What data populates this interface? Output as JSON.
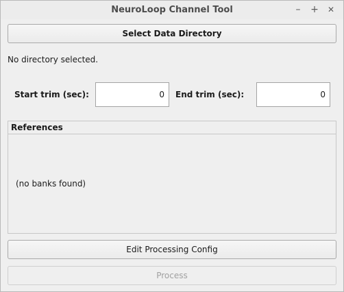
{
  "window": {
    "title": "NeuroLoop Channel Tool",
    "controls": [
      "minimize-icon",
      "maximize-icon",
      "close-icon"
    ],
    "minimize_glyph": "–",
    "maximize_glyph": "+",
    "close_glyph": "✕"
  },
  "directory": {
    "select_button": "Select Data Directory",
    "status": "No directory selected."
  },
  "trim": {
    "start_label": "Start trim (sec):",
    "start_value": "0",
    "end_label": "End trim (sec):",
    "end_value": "0"
  },
  "references": {
    "title": "References",
    "empty_text": "(no banks found)"
  },
  "actions": {
    "edit_config_button": "Edit Processing Config",
    "process_button": "Process"
  }
}
